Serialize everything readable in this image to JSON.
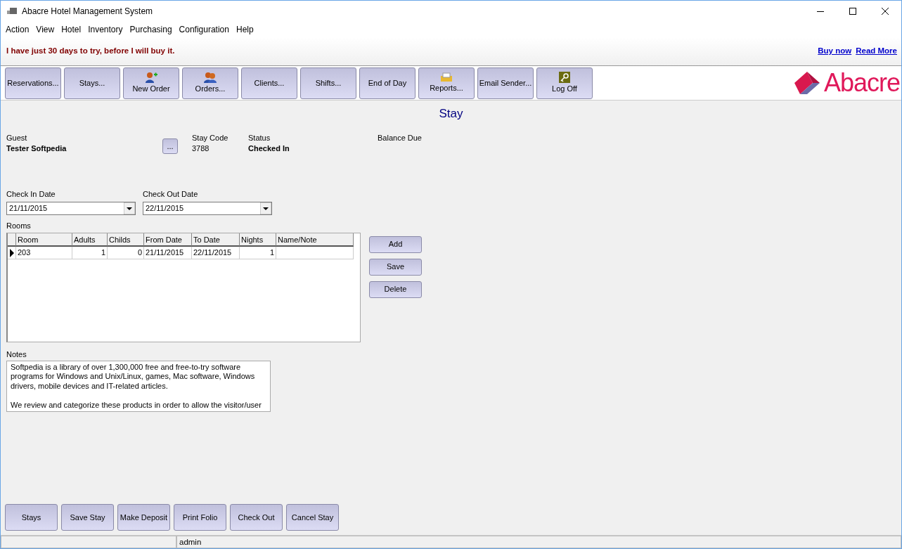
{
  "window": {
    "title": "Abacre Hotel Management System"
  },
  "menu": [
    "Action",
    "View",
    "Hotel",
    "Inventory",
    "Purchasing",
    "Configuration",
    "Help"
  ],
  "trial_banner": {
    "message": "I have just 30 days to try, before I will buy it.",
    "links": [
      "Buy now",
      "Read More"
    ]
  },
  "toolbar": [
    {
      "label": "Reservations..."
    },
    {
      "label": "Stays..."
    },
    {
      "label": "New Order"
    },
    {
      "label": "Orders..."
    },
    {
      "label": "Clients..."
    },
    {
      "label": "Shifts..."
    },
    {
      "label": "End of Day"
    },
    {
      "label": "Reports..."
    },
    {
      "label": "Email Sender..."
    },
    {
      "label": "Log Off"
    }
  ],
  "logo": {
    "text": "Abacre"
  },
  "page_title": "Stay",
  "guest": {
    "label": "Guest",
    "value": "Tester Softpedia",
    "browse_button": "..."
  },
  "stay_code": {
    "label": "Stay Code",
    "value": "3788"
  },
  "status": {
    "label": "Status",
    "value": "Checked In"
  },
  "balance_due": {
    "label": "Balance Due"
  },
  "check_in": {
    "label": "Check In Date",
    "value": "21/11/2015"
  },
  "check_out": {
    "label": "Check Out Date",
    "value": "22/11/2015"
  },
  "rooms": {
    "label": "Rooms",
    "columns": [
      "Room",
      "Adults",
      "Childs",
      "From Date",
      "To Date",
      "Nights",
      "Name/Note"
    ],
    "rows": [
      {
        "selected": true,
        "cells": [
          "203",
          "1",
          "0",
          "21/11/2015",
          "22/11/2015",
          "1",
          ""
        ]
      }
    ],
    "buttons": [
      "Add",
      "Save",
      "Delete"
    ]
  },
  "notes": {
    "label": "Notes",
    "value": "Softpedia is a library of over 1,300,000 free and free-to-try software programs for Windows and Unix/Linux, games, Mac software, Windows drivers, mobile devices and IT-related articles.\n\nWe review and categorize these products in order to allow the visitor/user"
  },
  "bottom_buttons": [
    "Stays",
    "Save Stay",
    "Make Deposit",
    "Print Folio",
    "Check Out",
    "Cancel Stay"
  ],
  "status_bar": {
    "user": "admin"
  }
}
